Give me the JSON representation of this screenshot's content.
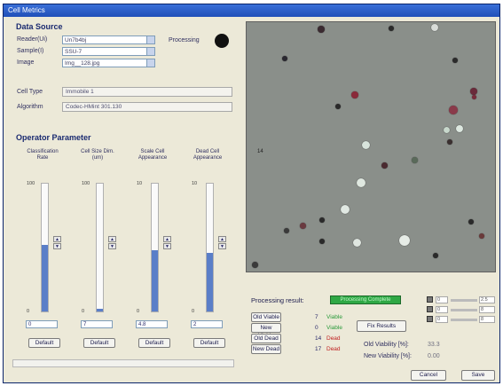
{
  "window": {
    "title": "Cell Metrics"
  },
  "data_source": {
    "heading": "Data Source",
    "reader_label": "Reader(Ui)",
    "reader_value": "Un7b4bj",
    "sample_label": "Sample(I)",
    "sample_value": "SSU-7",
    "image_label": "Image",
    "image_value": "Img__128.jpg",
    "processing_label": "Processing",
    "cell_type_label": "Cell Type",
    "cell_type_value": "Immobile 1",
    "algorithm_label": "Algorithm",
    "algorithm_value": "Codec-HMint 301.130"
  },
  "operator": {
    "heading": "Operator Parameter",
    "sliders": [
      {
        "label": "Classification Rate",
        "max": "100",
        "min": "0",
        "value": "0",
        "level": 0.52
      },
      {
        "label": "Cell Size Dim. (um)",
        "max": "100",
        "min": "0",
        "value": "7",
        "level": 0.02
      },
      {
        "label": "Scale Cell Appearance",
        "max": "10",
        "min": "0",
        "value": "4.8",
        "level": 0.48
      },
      {
        "label": "Dead Cell Appearance",
        "max": "10",
        "min": "0",
        "value": "2",
        "level": 0.46
      }
    ],
    "default_label": "Default"
  },
  "results": {
    "processing_result_label": "Processing result:",
    "status_value": "Processing Complete",
    "rows": [
      {
        "button": "Old Viable",
        "count": "7",
        "state": "Viable"
      },
      {
        "button": "New Viable",
        "count": "0",
        "state": "Viable"
      },
      {
        "button": "Old Dead",
        "count": "14",
        "state": "Dead"
      },
      {
        "button": "New Dead",
        "count": "17",
        "state": "Dead"
      }
    ],
    "fix_results": "Fix Results",
    "old_viability_label": "Old Viability [%]:",
    "old_viability_value": "33.3",
    "new_viability_label": "New Viability [%]:",
    "new_viability_value": "0.00"
  },
  "display": {
    "rows": [
      {
        "min": "0",
        "max": "2.5"
      },
      {
        "min": "0",
        "max": "8"
      },
      {
        "min": "0",
        "max": "8"
      }
    ]
  },
  "footer": {
    "cancel": "Cancel",
    "save": "Save"
  },
  "image_panel": {
    "marker": "14"
  },
  "colors": {
    "title": "#1f4fb8",
    "fill": "#5a7ec8",
    "ok": "#2fa845",
    "dead": "#c02020"
  }
}
